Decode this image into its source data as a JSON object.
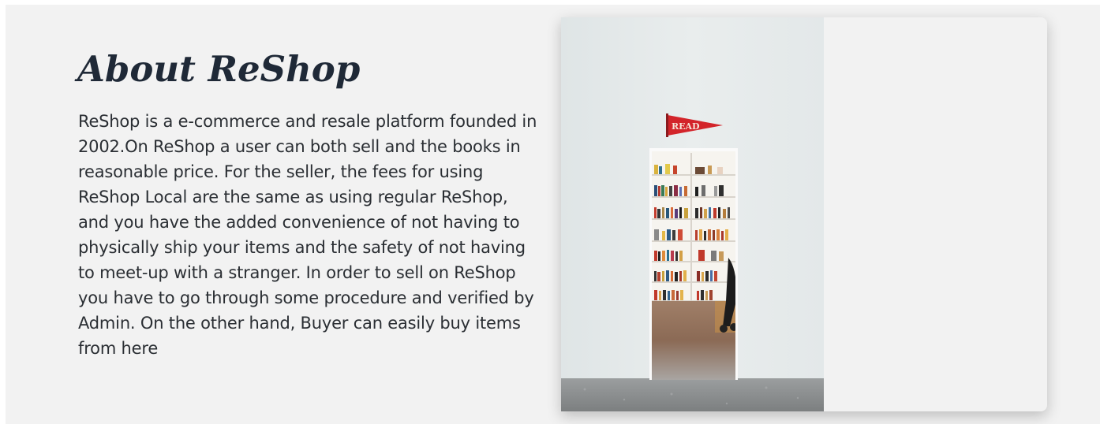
{
  "about": {
    "title": "About ReShop",
    "description": "ReShop is a e-commerce and resale platform founded in 2002.On ReShop a user can both sell and the books in reasonable price. For the seller, the fees for using ReShop Local are the same as using regular ReShop, and you have the added convenience of not having to physically ship your items and the safety of not having to meet-up with a stranger. In order to sell on ReShop you have to go through some procedure and verified by Admin. On the other hand, Buyer can easily buy items from here",
    "image": {
      "pennant_text": "READ"
    }
  }
}
